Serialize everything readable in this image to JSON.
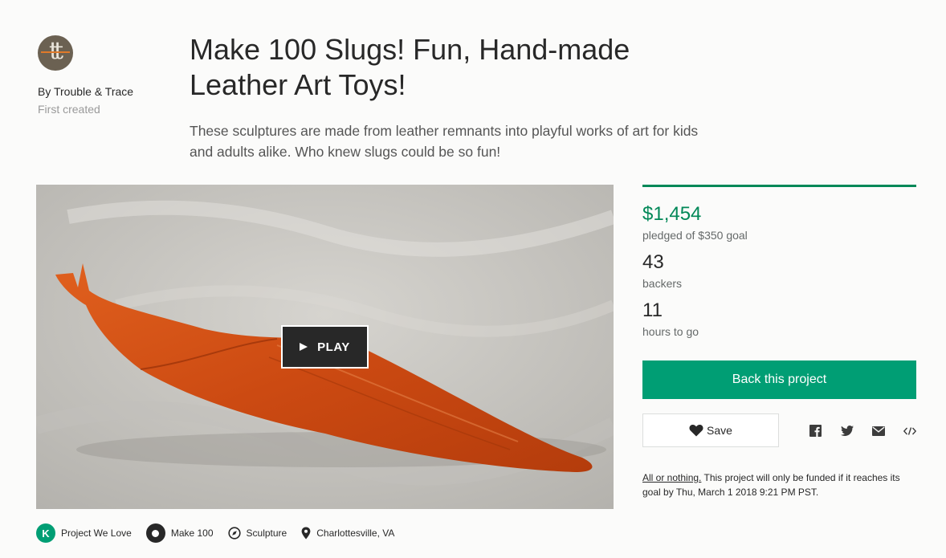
{
  "creator": {
    "avatar_initials": "tt",
    "by_line": "By Trouble & Trace",
    "first_created": "First created"
  },
  "project": {
    "title": "Make 100 Slugs! Fun, Hand-made Leather Art Toys!",
    "blurb": "These sculptures are made from leather remnants into playful works of art for kids and adults alike. Who knew slugs could be so fun!"
  },
  "video": {
    "play_label": "PLAY"
  },
  "stats": {
    "pledged": "$1,454",
    "pledged_label": "pledged of $350 goal",
    "funded_fraction": 1.0,
    "backers": "43",
    "backers_label": "backers",
    "time_left": "11",
    "time_left_label": "hours to go"
  },
  "actions": {
    "back_label": "Back this project",
    "save_label": "Save",
    "share_icons": [
      "facebook-icon",
      "twitter-icon",
      "email-icon",
      "embed-icon"
    ]
  },
  "funding_note": {
    "link_text": "All or nothing.",
    "text": " This project will only be funded if it reaches its goal by Thu, March 1 2018 9:21 PM PST."
  },
  "tags": [
    {
      "icon": "kickstarter-k-icon",
      "label": "Project We Love"
    },
    {
      "icon": "make-100-icon",
      "label": "Make 100"
    },
    {
      "icon": "compass-icon",
      "label": "Sculpture"
    },
    {
      "icon": "location-pin-icon",
      "label": "Charlottesville, VA"
    }
  ],
  "colors": {
    "accent_green": "#009e74",
    "pledged_green": "#028858",
    "dark": "#282828"
  }
}
